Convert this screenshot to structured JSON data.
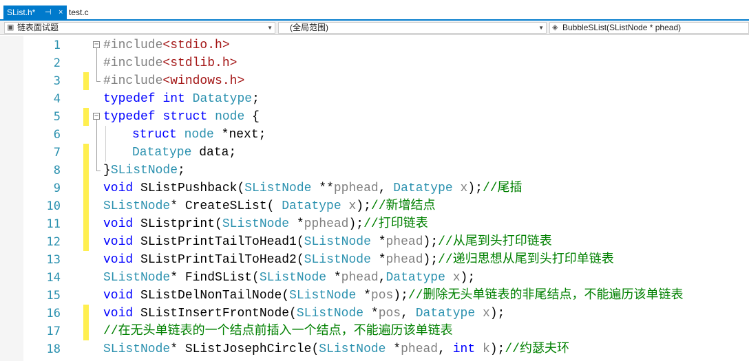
{
  "tabs": {
    "active_label": "SList.h*",
    "active_pin": "⊣",
    "active_close": "×",
    "inactive_label": "test.c"
  },
  "navbar": {
    "project": "链表面试题",
    "scope": "(全局范围)",
    "member": "BubbleSList(SListNode * phead)"
  },
  "editor": {
    "lines": [
      {
        "n": "1",
        "parts": [
          [
            "pp",
            "#include"
          ],
          [
            "str",
            "<stdio.h>"
          ]
        ],
        "indent": 0,
        "fold": "open",
        "bar": false
      },
      {
        "n": "2",
        "parts": [
          [
            "pp",
            "#include"
          ],
          [
            "str",
            "<stdlib.h>"
          ]
        ],
        "indent": 0,
        "fold": "mid",
        "bar": false
      },
      {
        "n": "3",
        "parts": [
          [
            "pp",
            "#include"
          ],
          [
            "str",
            "<windows.h>"
          ]
        ],
        "indent": 0,
        "fold": "end",
        "bar": true
      },
      {
        "n": "4",
        "parts": [
          [
            "kw",
            "typedef"
          ],
          [
            "pl",
            " "
          ],
          [
            "kw",
            "int"
          ],
          [
            "pl",
            " "
          ],
          [
            "ty",
            "Datatype"
          ],
          [
            "pl",
            ";"
          ]
        ],
        "indent": 0,
        "fold": "none",
        "bar": false
      },
      {
        "n": "5",
        "parts": [
          [
            "kw",
            "typedef"
          ],
          [
            "pl",
            " "
          ],
          [
            "kw",
            "struct"
          ],
          [
            "pl",
            " "
          ],
          [
            "ty",
            "node"
          ],
          [
            "pl",
            " {"
          ]
        ],
        "indent": 0,
        "fold": "open",
        "bar": true
      },
      {
        "n": "6",
        "parts": [
          [
            "kw",
            "struct"
          ],
          [
            "pl",
            " "
          ],
          [
            "ty",
            "node"
          ],
          [
            "pl",
            " *next;"
          ]
        ],
        "indent": 1,
        "fold": "mid",
        "bar": false
      },
      {
        "n": "7",
        "parts": [
          [
            "ty",
            "Datatype"
          ],
          [
            "pl",
            " data;"
          ]
        ],
        "indent": 1,
        "fold": "mid",
        "bar": true
      },
      {
        "n": "8",
        "parts": [
          [
            "pl",
            "}"
          ],
          [
            "ty",
            "SListNode"
          ],
          [
            "pl",
            ";"
          ]
        ],
        "indent": 0,
        "fold": "end",
        "bar": true
      },
      {
        "n": "9",
        "parts": [
          [
            "kw",
            "void"
          ],
          [
            "pl",
            " SListPushback("
          ],
          [
            "ty",
            "SListNode"
          ],
          [
            "pl",
            " **"
          ],
          [
            "pm",
            "pphead"
          ],
          [
            "pl",
            ", "
          ],
          [
            "ty",
            "Datatype"
          ],
          [
            "pl",
            " "
          ],
          [
            "pm",
            "x"
          ],
          [
            "pl",
            ");"
          ],
          [
            "cm",
            "//尾插"
          ]
        ],
        "indent": 0,
        "fold": "none",
        "bar": true
      },
      {
        "n": "10",
        "parts": [
          [
            "ty",
            "SListNode"
          ],
          [
            "pl",
            "* CreateSList( "
          ],
          [
            "ty",
            "Datatype"
          ],
          [
            "pl",
            " "
          ],
          [
            "pm",
            "x"
          ],
          [
            "pl",
            ");"
          ],
          [
            "cm",
            "//新增结点"
          ]
        ],
        "indent": 0,
        "fold": "none",
        "bar": true
      },
      {
        "n": "11",
        "parts": [
          [
            "kw",
            "void"
          ],
          [
            "pl",
            " SListprint("
          ],
          [
            "ty",
            "SListNode"
          ],
          [
            "pl",
            " *"
          ],
          [
            "pm",
            "pphead"
          ],
          [
            "pl",
            ");"
          ],
          [
            "cm",
            "//打印链表"
          ]
        ],
        "indent": 0,
        "fold": "none",
        "bar": true
      },
      {
        "n": "12",
        "parts": [
          [
            "kw",
            "void"
          ],
          [
            "pl",
            " SListPrintTailToHead1("
          ],
          [
            "ty",
            "SListNode"
          ],
          [
            "pl",
            " *"
          ],
          [
            "pm",
            "phead"
          ],
          [
            "pl",
            ");"
          ],
          [
            "cm",
            "//从尾到头打印链表"
          ]
        ],
        "indent": 0,
        "fold": "none",
        "bar": true
      },
      {
        "n": "13",
        "parts": [
          [
            "kw",
            "void"
          ],
          [
            "pl",
            " SListPrintTailToHead2("
          ],
          [
            "ty",
            "SListNode"
          ],
          [
            "pl",
            " *"
          ],
          [
            "pm",
            "phead"
          ],
          [
            "pl",
            ");"
          ],
          [
            "cm",
            "//递归思想从尾到头打印单链表"
          ]
        ],
        "indent": 0,
        "fold": "none",
        "bar": false
      },
      {
        "n": "14",
        "parts": [
          [
            "ty",
            "SListNode"
          ],
          [
            "pl",
            "* FindSList("
          ],
          [
            "ty",
            "SListNode"
          ],
          [
            "pl",
            " *"
          ],
          [
            "pm",
            "phead"
          ],
          [
            "pl",
            ","
          ],
          [
            "ty",
            "Datatype"
          ],
          [
            "pl",
            " "
          ],
          [
            "pm",
            "x"
          ],
          [
            "pl",
            ");"
          ]
        ],
        "indent": 0,
        "fold": "none",
        "bar": false
      },
      {
        "n": "15",
        "parts": [
          [
            "kw",
            "void"
          ],
          [
            "pl",
            " SListDelNonTailNode("
          ],
          [
            "ty",
            "SListNode"
          ],
          [
            "pl",
            " *"
          ],
          [
            "pm",
            "pos"
          ],
          [
            "pl",
            ");"
          ],
          [
            "cm",
            "//删除无头单链表的非尾结点，不能遍历该单链表"
          ]
        ],
        "indent": 0,
        "fold": "none",
        "bar": false
      },
      {
        "n": "16",
        "parts": [
          [
            "kw",
            "void"
          ],
          [
            "pl",
            " SListInsertFrontNode("
          ],
          [
            "ty",
            "SListNode"
          ],
          [
            "pl",
            " *"
          ],
          [
            "pm",
            "pos"
          ],
          [
            "pl",
            ", "
          ],
          [
            "ty",
            "Datatype"
          ],
          [
            "pl",
            " "
          ],
          [
            "pm",
            "x"
          ],
          [
            "pl",
            ");"
          ]
        ],
        "indent": 0,
        "fold": "none",
        "bar": true
      },
      {
        "n": "17",
        "parts": [
          [
            "cm",
            "//在无头单链表的一个结点前插入一个结点，不能遍历该单链表"
          ]
        ],
        "indent": 0,
        "fold": "none",
        "bar": true
      },
      {
        "n": "18",
        "parts": [
          [
            "ty",
            "SListNode"
          ],
          [
            "pl",
            "* SListJosephCircle("
          ],
          [
            "ty",
            "SListNode"
          ],
          [
            "pl",
            " *"
          ],
          [
            "pm",
            "phead"
          ],
          [
            "pl",
            ", "
          ],
          [
            "kw",
            "int"
          ],
          [
            "pl",
            " "
          ],
          [
            "pm",
            "k"
          ],
          [
            "pl",
            ");"
          ],
          [
            "cm",
            "//约瑟夫环"
          ]
        ],
        "indent": 0,
        "fold": "none",
        "bar": false
      }
    ]
  }
}
